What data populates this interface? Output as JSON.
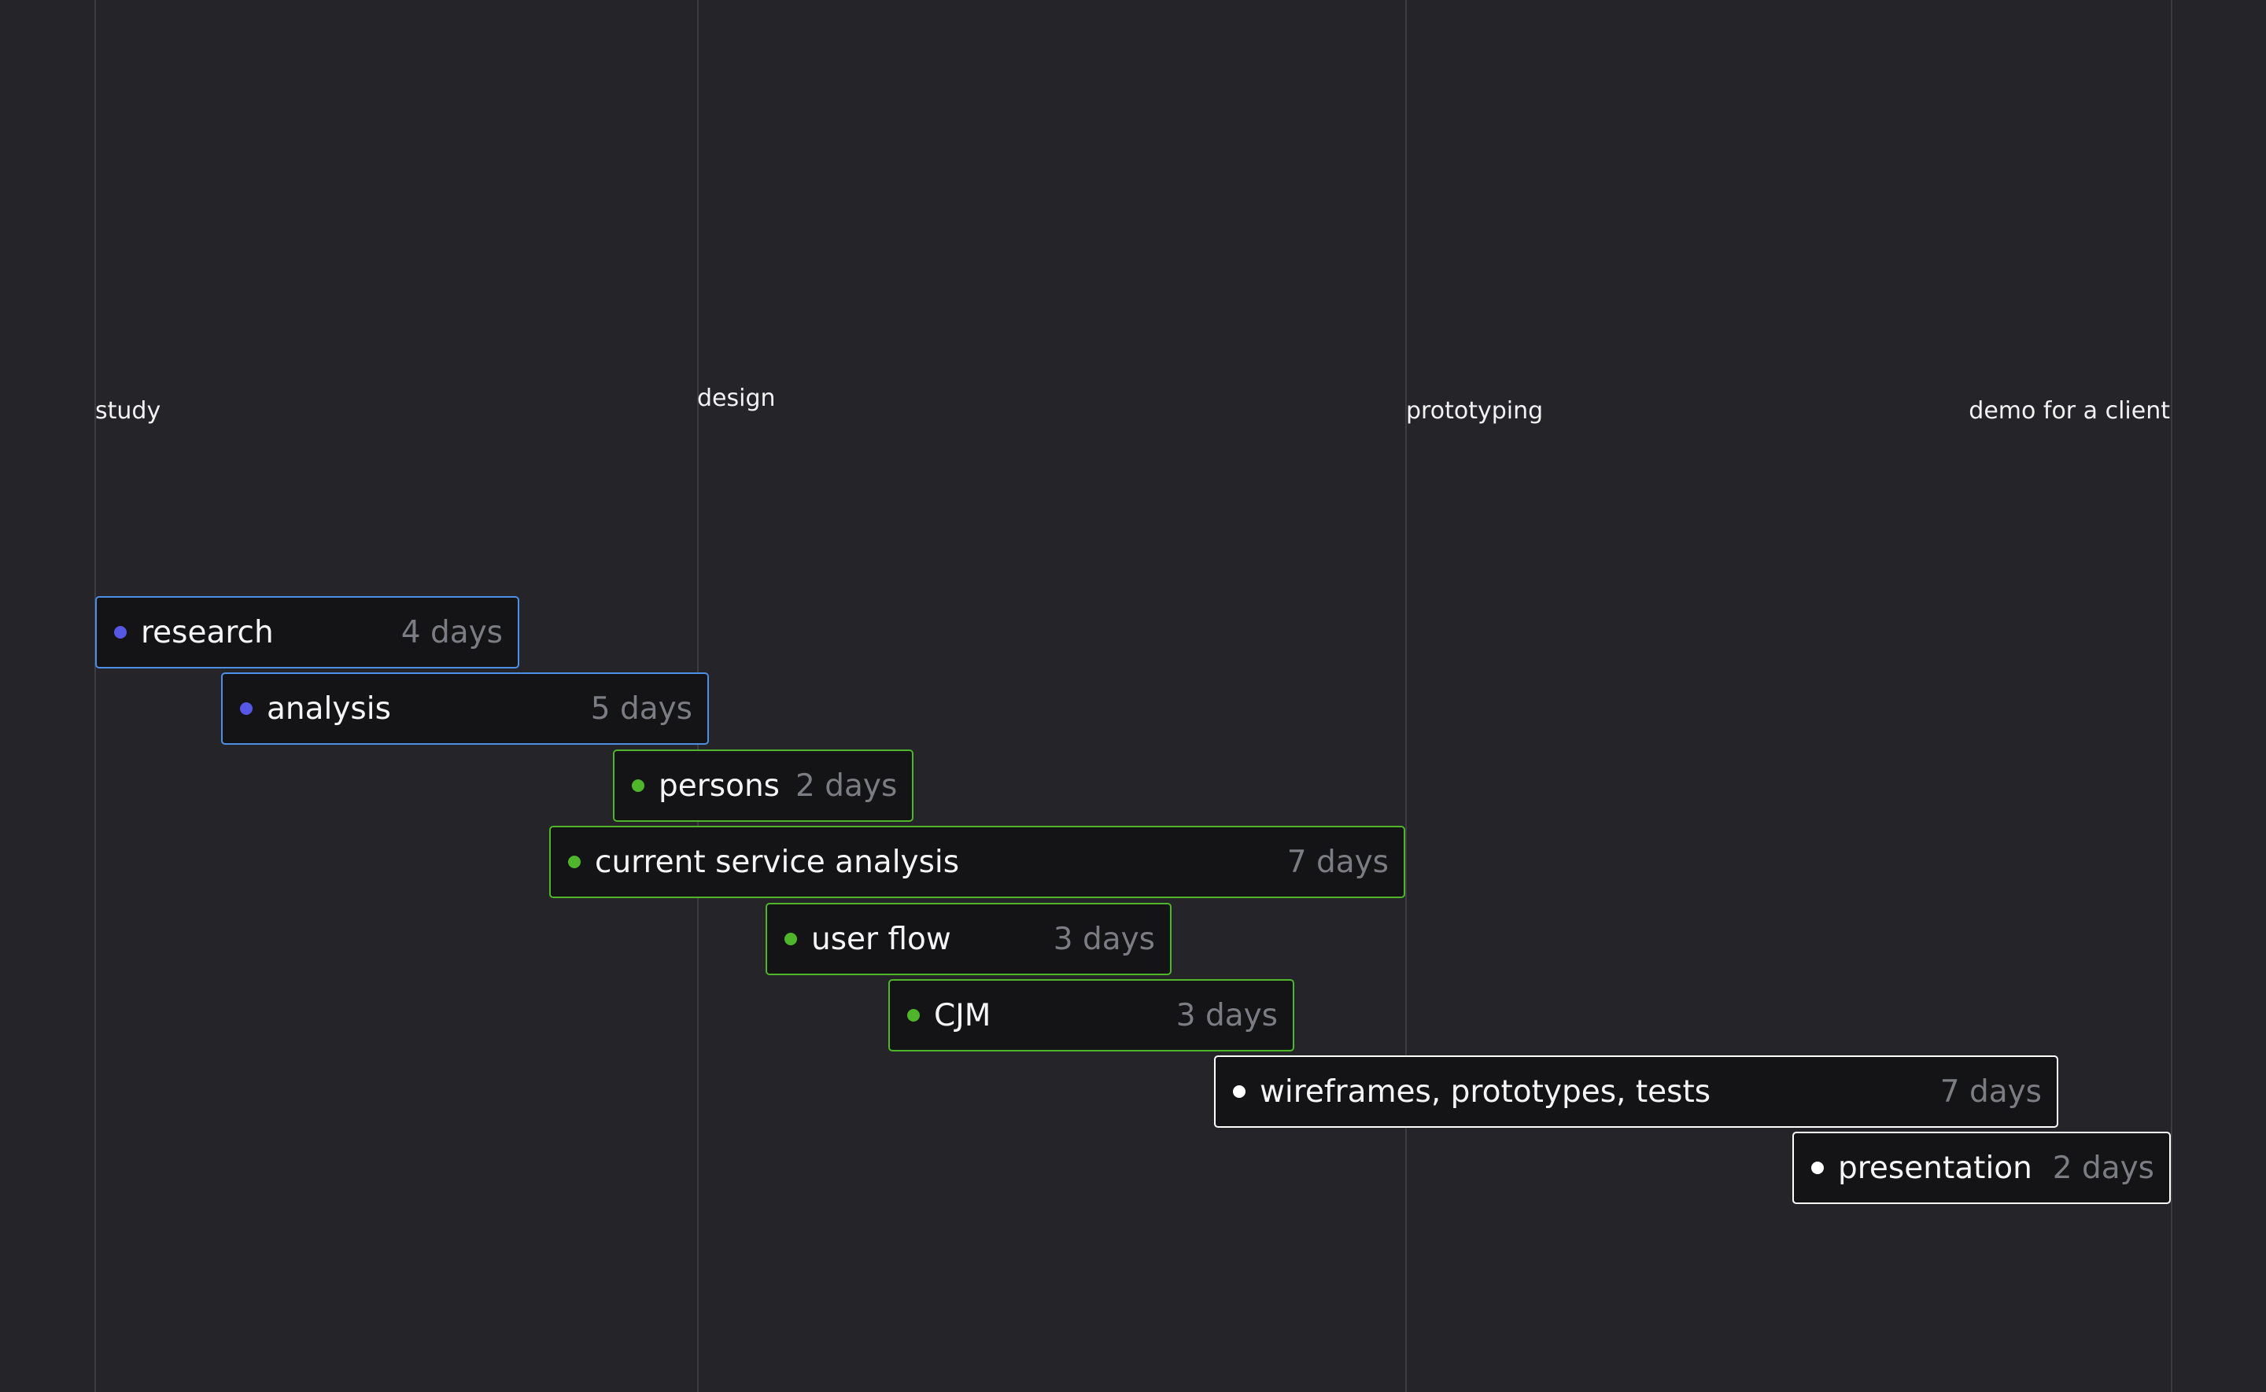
{
  "phases": [
    {
      "label": "study"
    },
    {
      "label": "design"
    },
    {
      "label": "prototyping"
    },
    {
      "label": "demo for a client"
    }
  ],
  "tasks": [
    {
      "name": "research",
      "duration": "4 days",
      "color": "#4e8fe6"
    },
    {
      "name": "analysis",
      "duration": "5 days",
      "color": "#4e8fe6"
    },
    {
      "name": "persons",
      "duration": "2 days",
      "color": "#4fb52b"
    },
    {
      "name": "current service analysis",
      "duration": "7 days",
      "color": "#4fb52b"
    },
    {
      "name": "user flow",
      "duration": "3 days",
      "color": "#4fb52b"
    },
    {
      "name": "CJM",
      "duration": "3 days",
      "color": "#4fb52b"
    },
    {
      "name": "wireframes, prototypes, tests",
      "duration": "7 days",
      "color": "#ffffff"
    },
    {
      "name": "presentation",
      "duration": "2 days",
      "color": "#ffffff"
    }
  ],
  "colors": {
    "background": "#242429",
    "gridline": "#3c3c42",
    "task_fill": "#141416",
    "blue_border": "#4e8fe6",
    "blue_dot": "#5757e6",
    "green": "#4fb52b",
    "white": "#ffffff",
    "duration_text": "#7c7c84"
  }
}
